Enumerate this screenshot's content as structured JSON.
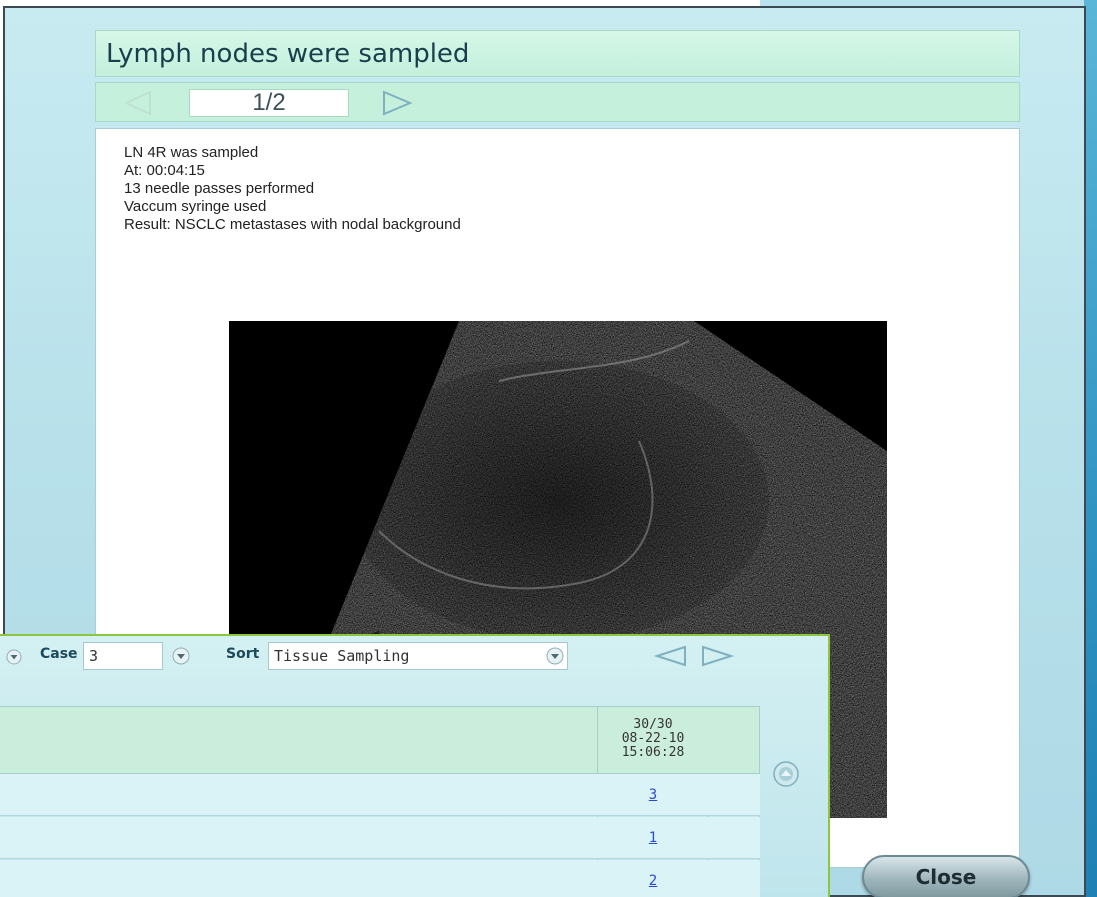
{
  "report": {
    "title": "Lymph nodes were sampled",
    "page_indicator": "1/2",
    "lines": [
      "LN 4R was sampled",
      "At: 00:04:15",
      "13 needle passes performed",
      "Vaccum syringe used",
      "Result: NSCLC metastases with nodal background"
    ],
    "close_label": "Close"
  },
  "toolbar": {
    "case_label": "Case",
    "case_value": "3",
    "sort_label": "Sort",
    "sort_value": "Tissue Sampling"
  },
  "grid": {
    "header_lines": [
      "30/30",
      "08-22-10",
      "15:06:28"
    ],
    "rows": [
      {
        "link": "3"
      },
      {
        "link": "1"
      },
      {
        "link": "2"
      }
    ]
  },
  "icons": {
    "prev": "triangle-left-icon",
    "next": "triangle-right-icon",
    "dropdown": "dropdown-circle-icon",
    "scroll_up": "scroll-up-icon"
  },
  "colors": {
    "accent_green": "#c4f0dc",
    "window_blue": "#bfe5ec",
    "link_blue": "#2a4bd0",
    "front_border": "#8cc63f"
  }
}
